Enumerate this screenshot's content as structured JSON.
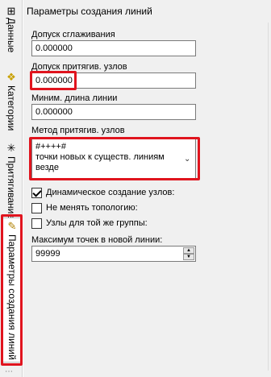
{
  "tabs": [
    {
      "label": "Данные",
      "icon": "data-tab-icon"
    },
    {
      "label": "Категории",
      "icon": "categories-tab-icon"
    },
    {
      "label": "Притягивание",
      "icon": "snap-tab-icon"
    },
    {
      "label": "Параметры создания линий",
      "icon": "pencil-icon",
      "active": true
    }
  ],
  "panel": {
    "title": "Параметры создания линий"
  },
  "form": {
    "smooth_tol_label": "Допуск сглаживания",
    "smooth_tol_value": "0.000000",
    "snap_tol_label": "Допуск притягив. узлов",
    "snap_tol_value": "0.000000",
    "min_len_label": "Миним. длина линии",
    "min_len_value": "0.000000",
    "snap_method_label": "Метод притягив. узлов",
    "snap_method_line1": "#++++#",
    "snap_method_line2": "точки новых к существ. линиям",
    "snap_method_line3": "везде",
    "dynamic_nodes_label": "Динамическое создание узлов:",
    "dynamic_nodes_checked": true,
    "keep_topology_label": "Не менять топологию:",
    "keep_topology_checked": false,
    "same_group_label": "Узлы для той же группы:",
    "same_group_checked": false,
    "max_points_label": "Максимум точек в новой линии:",
    "max_points_value": "99999"
  },
  "colors": {
    "highlight": "#e0141e",
    "panel_bg": "#f0f0f0"
  }
}
